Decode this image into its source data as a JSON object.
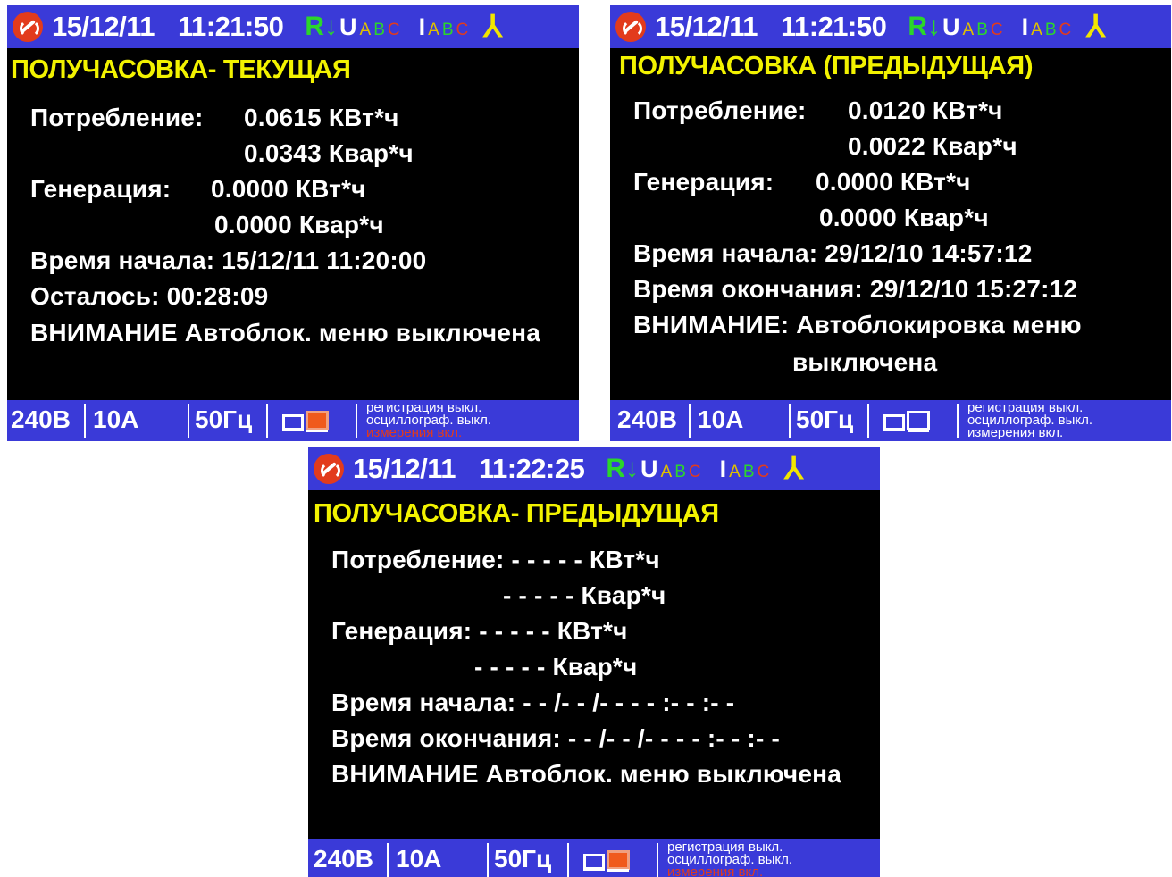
{
  "status_bar": {
    "channel_u": "U",
    "channel_i": "I",
    "phases": "ABC",
    "colors": {
      "bar": "#3a3ad8",
      "title": "#f2f200",
      "relay": "#2bd62b"
    }
  },
  "screens": [
    {
      "date": "15/12/11",
      "time": "11:21:50",
      "title": "ПОЛУЧАСОВКА- ТЕКУЩАЯ",
      "lines": [
        "Потребление:",
        "0.0615  КВт*ч",
        "0.0343  Квар*ч",
        "Генерация:",
        "0.0000  КВт*ч",
        "0.0000  Квар*ч",
        "Время  начала: 15/12/11  11:20:00",
        "Осталось: 00:28:09",
        "ВНИМАНИЕ  Автоблок. меню  выключена"
      ]
    },
    {
      "date": "15/12/11",
      "time": "11:21:50",
      "title": "ПОЛУЧАСОВКА  (ПРЕДЫДУЩАЯ)",
      "lines": [
        "Потребление:",
        "0.0120  КВт*ч",
        "0.0022  Квар*ч",
        "Генерация:",
        "0.0000  КВт*ч",
        "0.0000  Квар*ч",
        "Время  начала: 29/12/10  14:57:12",
        "Время  окончания: 29/12/10  15:27:12",
        "ВНИМАНИЕ:  Автоблокировка  меню",
        "выключена"
      ]
    },
    {
      "date": "15/12/11",
      "time": "11:22:25",
      "title": "ПОЛУЧАСОВКА- ПРЕДЫДУЩАЯ",
      "lines": [
        "Потребление: - - - - -   КВт*ч",
        "- - - - -   Квар*ч",
        "Генерация: - - - - -   КВт*ч",
        "- - - - -   Квар*ч",
        "Время  начала: - - /- - /- -   - - :- - :- -",
        "Время  окончания: - - /- - /- -   - - :- - :- -",
        "ВНИМАНИЕ  Автоблок. меню  выключена"
      ]
    }
  ],
  "bottom_bar": {
    "voltage": "240В",
    "current": "10А",
    "frequency": "50Гц",
    "registration": "регистрация  выкл.",
    "oscillograph": "осциллограф.  выкл.",
    "measurements": "измерения  вкл."
  }
}
